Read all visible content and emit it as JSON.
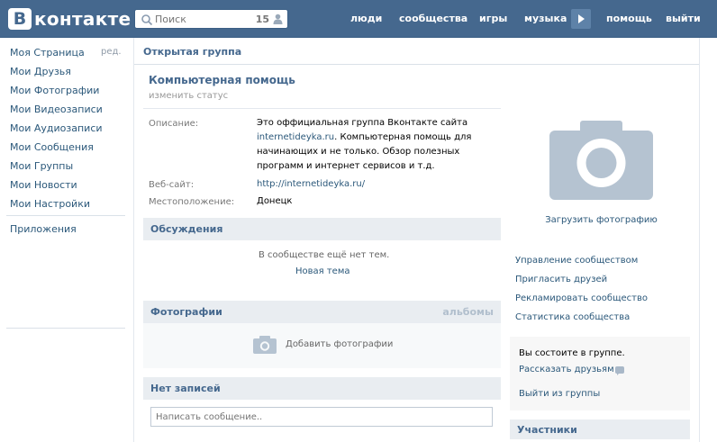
{
  "header": {
    "logo_badge": "В",
    "logo_text": "контакте",
    "search_placeholder": "Поиск",
    "search_count": "15",
    "nav": [
      "люди",
      "сообщества",
      "игры",
      "музыка",
      "помощь",
      "выйти"
    ]
  },
  "sidebar": {
    "items": [
      "Моя Страница",
      "Мои Друзья",
      "Мои Фотографии",
      "Мои Видеозаписи",
      "Мои Аудиозаписи",
      "Мои Сообщения",
      "Мои Группы",
      "Мои Новости",
      "Мои Настройки"
    ],
    "edit": "ред.",
    "apps": "Приложения"
  },
  "page": {
    "breadcrumb": "Открытая группа",
    "group_name": "Компьютерная помощь",
    "status": "изменить статус",
    "info": {
      "desc_label": "Описание:",
      "desc_line1": "Это оффициальная группа Вконтакте сайта",
      "desc_link": "internetideyka.ru",
      "desc_line2_rest": ". Компьютерная помощь для",
      "desc_line3": "начинающих и не только. Обзор полезных",
      "desc_line4": "программ и интернет сервисов и т.д.",
      "website_label": "Веб-сайт:",
      "website": "http://internetideyka.ru/",
      "location_label": "Местоположение:",
      "location": "Донецк"
    },
    "discussions": {
      "title": "Обсуждения",
      "empty": "В сообществе ещё нет тем.",
      "new_topic": "Новая тема"
    },
    "photos": {
      "title": "Фотографии",
      "albums": "альбомы",
      "add": "Добавить фотографии"
    },
    "wall": {
      "title": "Нет записей",
      "placeholder": "Написать сообщение.."
    }
  },
  "right": {
    "upload_photo": "Загрузить фотографию",
    "links": [
      "Управление сообществом",
      "Пригласить друзей",
      "Рекламировать сообщество",
      "Статистика сообщества"
    ],
    "member_status": "Вы состоите в группе.",
    "tell_friends": "Рассказать друзьям",
    "leave": "Выйти из группы",
    "members_title": "Участники"
  },
  "colors": {
    "brand": "#45688e",
    "link": "#2b587a",
    "section_bg": "#e9edf1"
  }
}
